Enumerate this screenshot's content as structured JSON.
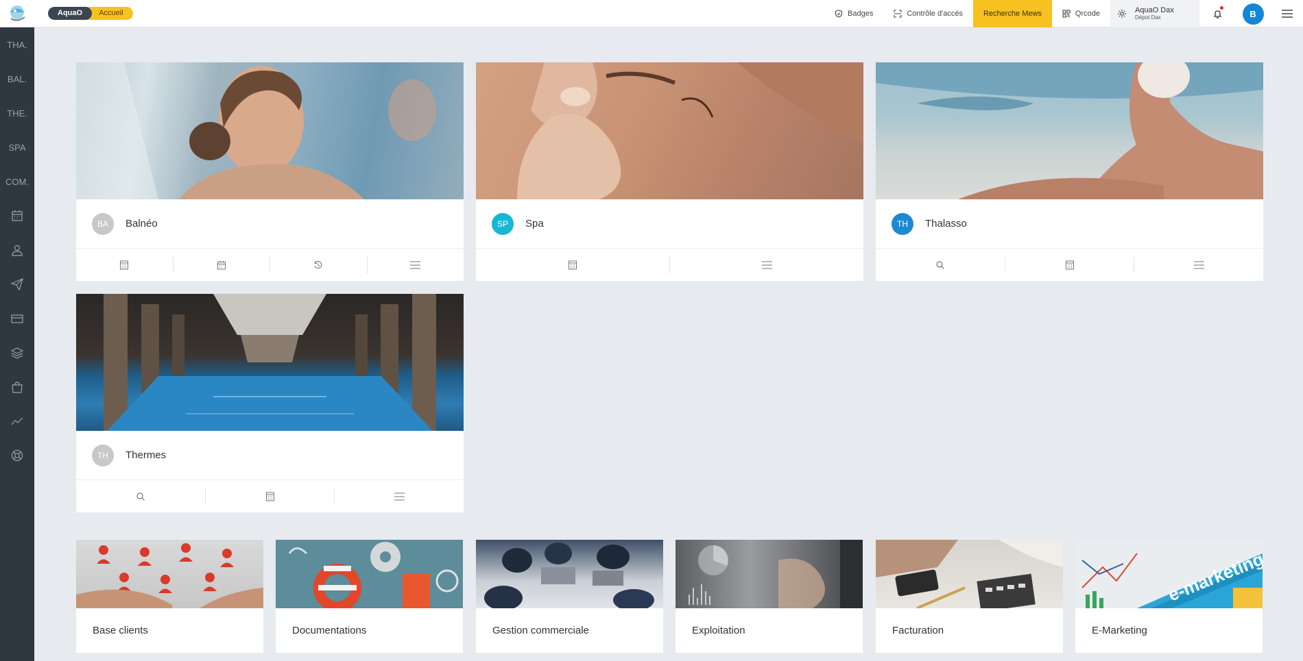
{
  "header": {
    "app_pill": "AquaO",
    "page_pill": "Accueil",
    "nav": [
      {
        "label": "Badges",
        "icon": "shield-icon"
      },
      {
        "label": "Contrôle d'accès",
        "icon": "scan-icon"
      },
      {
        "label": "Recherche Mews",
        "icon": "none",
        "active": true
      },
      {
        "label": "Qrcode",
        "icon": "qrcode-icon"
      }
    ],
    "site_name": "AquaO Dax",
    "site_sub": "Dépot Dax",
    "user_initial": "B"
  },
  "sidebar": {
    "text_items": [
      "THA.",
      "BAL.",
      "THE.",
      "SPA",
      "COM."
    ],
    "icon_items": [
      "calendar-icon",
      "user-icon",
      "send-icon",
      "credit-card-icon",
      "layers-icon",
      "shopping-bag-icon",
      "trend-chart-icon",
      "support-icon"
    ]
  },
  "cards": [
    {
      "initials": "BA",
      "title": "Balnéo",
      "badge_color": "#c8c8c8",
      "actions": [
        "calculator-icon",
        "calendar-icon",
        "history-icon",
        "menu-icon"
      ]
    },
    {
      "initials": "SP",
      "title": "Spa",
      "badge_color": "#17b7d4",
      "actions": [
        "calculator-icon",
        "menu-icon"
      ]
    },
    {
      "initials": "TH",
      "title": "Thalasso",
      "badge_color": "#1b8ad0",
      "actions": [
        "search-icon",
        "calculator-icon",
        "menu-icon"
      ]
    },
    {
      "initials": "TH",
      "title": "Thermes",
      "badge_color": "#c8c8c8",
      "actions": [
        "search-icon",
        "calculator-icon",
        "menu-icon"
      ]
    }
  ],
  "tiles": [
    {
      "title": "Base clients"
    },
    {
      "title": "Documentations"
    },
    {
      "title": "Gestion commerciale"
    },
    {
      "title": "Exploitation"
    },
    {
      "title": "Facturation"
    },
    {
      "title": "E-Marketing"
    }
  ],
  "colors": {
    "accent": "#f7c122",
    "sidebar": "#2f3740",
    "background": "#e7ebef",
    "primary": "#1585d8"
  }
}
